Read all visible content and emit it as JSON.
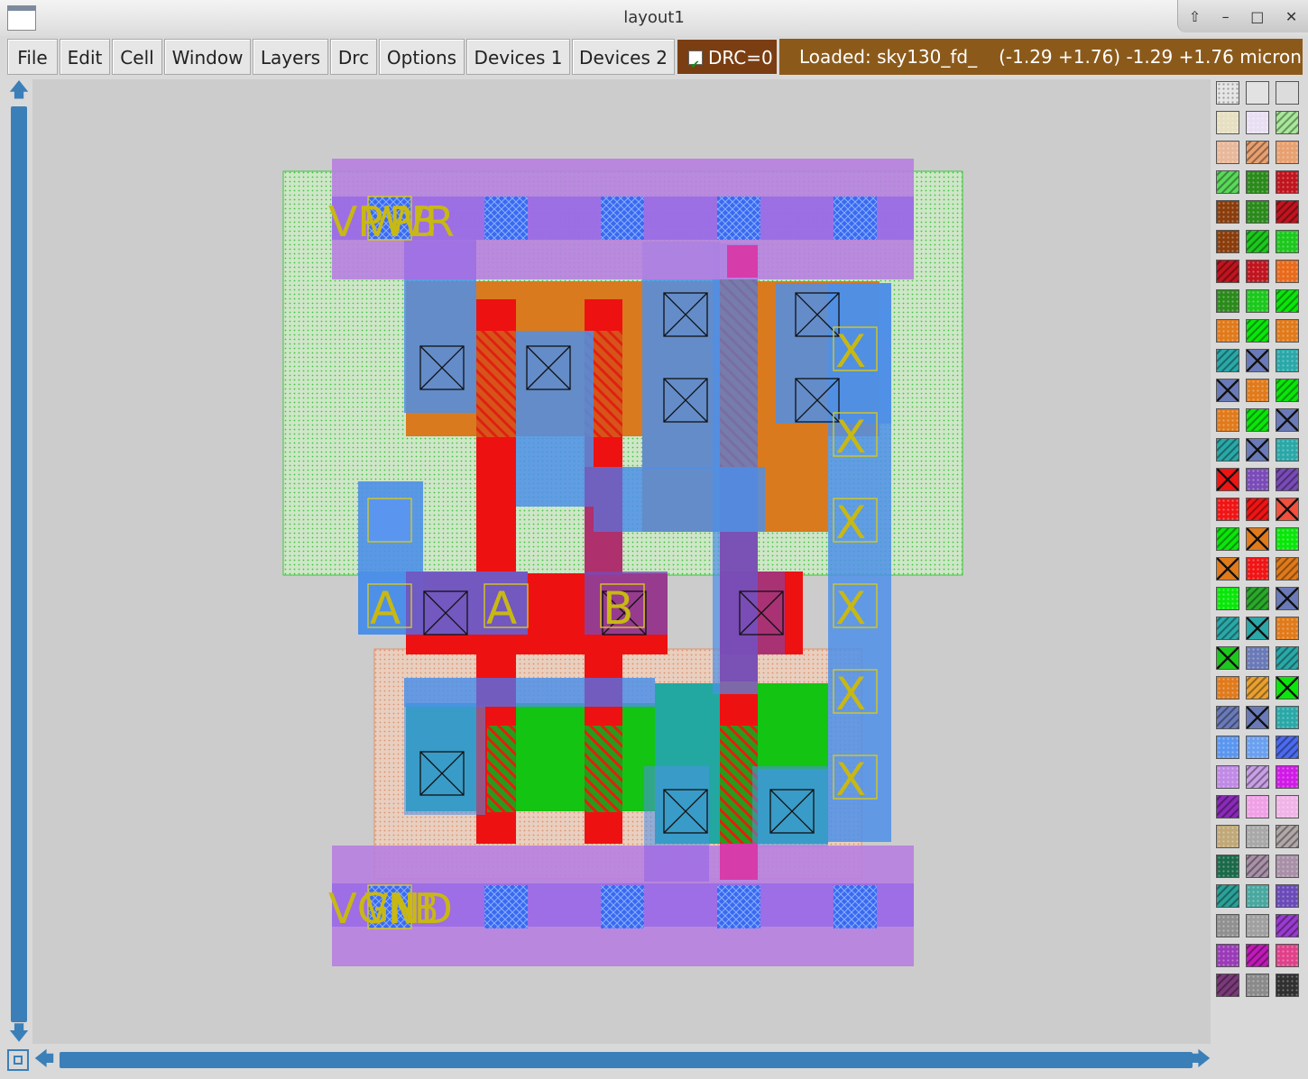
{
  "window": {
    "title": "layout1"
  },
  "menu": {
    "items": [
      "File",
      "Edit",
      "Cell",
      "Window",
      "Layers",
      "Drc",
      "Options",
      "Devices 1",
      "Devices 2"
    ]
  },
  "drc": {
    "label": "DRC=0",
    "checked": true
  },
  "status": {
    "loaded": "Loaded: sky130_fd_",
    "coords": "(-1.29 +1.76) -1.29 +1.76 microns"
  },
  "layout": {
    "labels": {
      "power": "VPWR",
      "power_overlap": "VPB",
      "ground": "VGND",
      "ground_overlap": "VNB",
      "input_a": "A",
      "input_b": "B",
      "output": "X"
    }
  },
  "palette": {
    "rows": [
      [
        "#e6e6e6",
        "#e2e2e2",
        "#dcdcdc"
      ],
      [
        "#e6dfc2",
        "#e8e0f2",
        "#a8e89a"
      ],
      [
        "#e8b89a",
        "#e8a070",
        "#e8a070"
      ],
      [
        "#5ad85a",
        "#2a8a1a",
        "#c0141e"
      ],
      [
        "#8a3c0a",
        "#2a8a1a",
        "#c0141e"
      ],
      [
        "#8a3c0a",
        "#1cc81c",
        "#1cc81c"
      ],
      [
        "#c0141e",
        "#c0141e",
        "#e86a1a"
      ],
      [
        "#2a8a1a",
        "#1cc81c",
        "#0ae60a"
      ],
      [
        "#e07a1a",
        "#0ae60a",
        "#e07a1a"
      ],
      [
        "#2aa8a8",
        "#6a7ab8",
        "#2aa8a8"
      ],
      [
        "#6a7ab8",
        "#e07a1a",
        "#0ae60a"
      ],
      [
        "#e07a1a",
        "#0ae60a",
        "#6a7ab8"
      ],
      [
        "#2aa8a8",
        "#6a7ab8",
        "#2aa8a8"
      ],
      [
        "#f01414",
        "#7a4ab8",
        "#7a4ab8"
      ],
      [
        "#f01414",
        "#f01414",
        "#f0503c"
      ],
      [
        "#0ae60a",
        "#e07a1a",
        "#0ae60a"
      ],
      [
        "#e07a1a",
        "#f01414",
        "#e07a1a"
      ],
      [
        "#0ae60a",
        "#2aa82a",
        "#6a7ab8"
      ],
      [
        "#2aa8a8",
        "#2aa8a8",
        "#e07a1a"
      ],
      [
        "#1cc81c",
        "#6a7ab8",
        "#2aa8a8"
      ],
      [
        "#e07a1a",
        "#e8a030",
        "#0ae60a"
      ],
      [
        "#6a7ab8",
        "#6a7ab8",
        "#2aa8a8"
      ],
      [
        "#5a96f0",
        "#6aa0f0",
        "#4a6af0"
      ],
      [
        "#c08ae6",
        "#c8a0e6",
        "#d01ae6"
      ],
      [
        "#8a2ab8",
        "#f0a0e6",
        "#f0b4e6"
      ],
      [
        "#c0a878",
        "#a8a8a8",
        "#b0a8a8"
      ],
      [
        "#1a6a4a",
        "#a890a8",
        "#a890a8"
      ],
      [
        "#2aa098",
        "#48a8a0",
        "#6a4ab8"
      ],
      [
        "#909090",
        "#a0a0a0",
        "#9a3ad0"
      ],
      [
        "#9a3ab8",
        "#c01ab8",
        "#e0408a"
      ],
      [
        "#7a3a7a",
        "#8a8a8a",
        "#303030"
      ]
    ]
  }
}
